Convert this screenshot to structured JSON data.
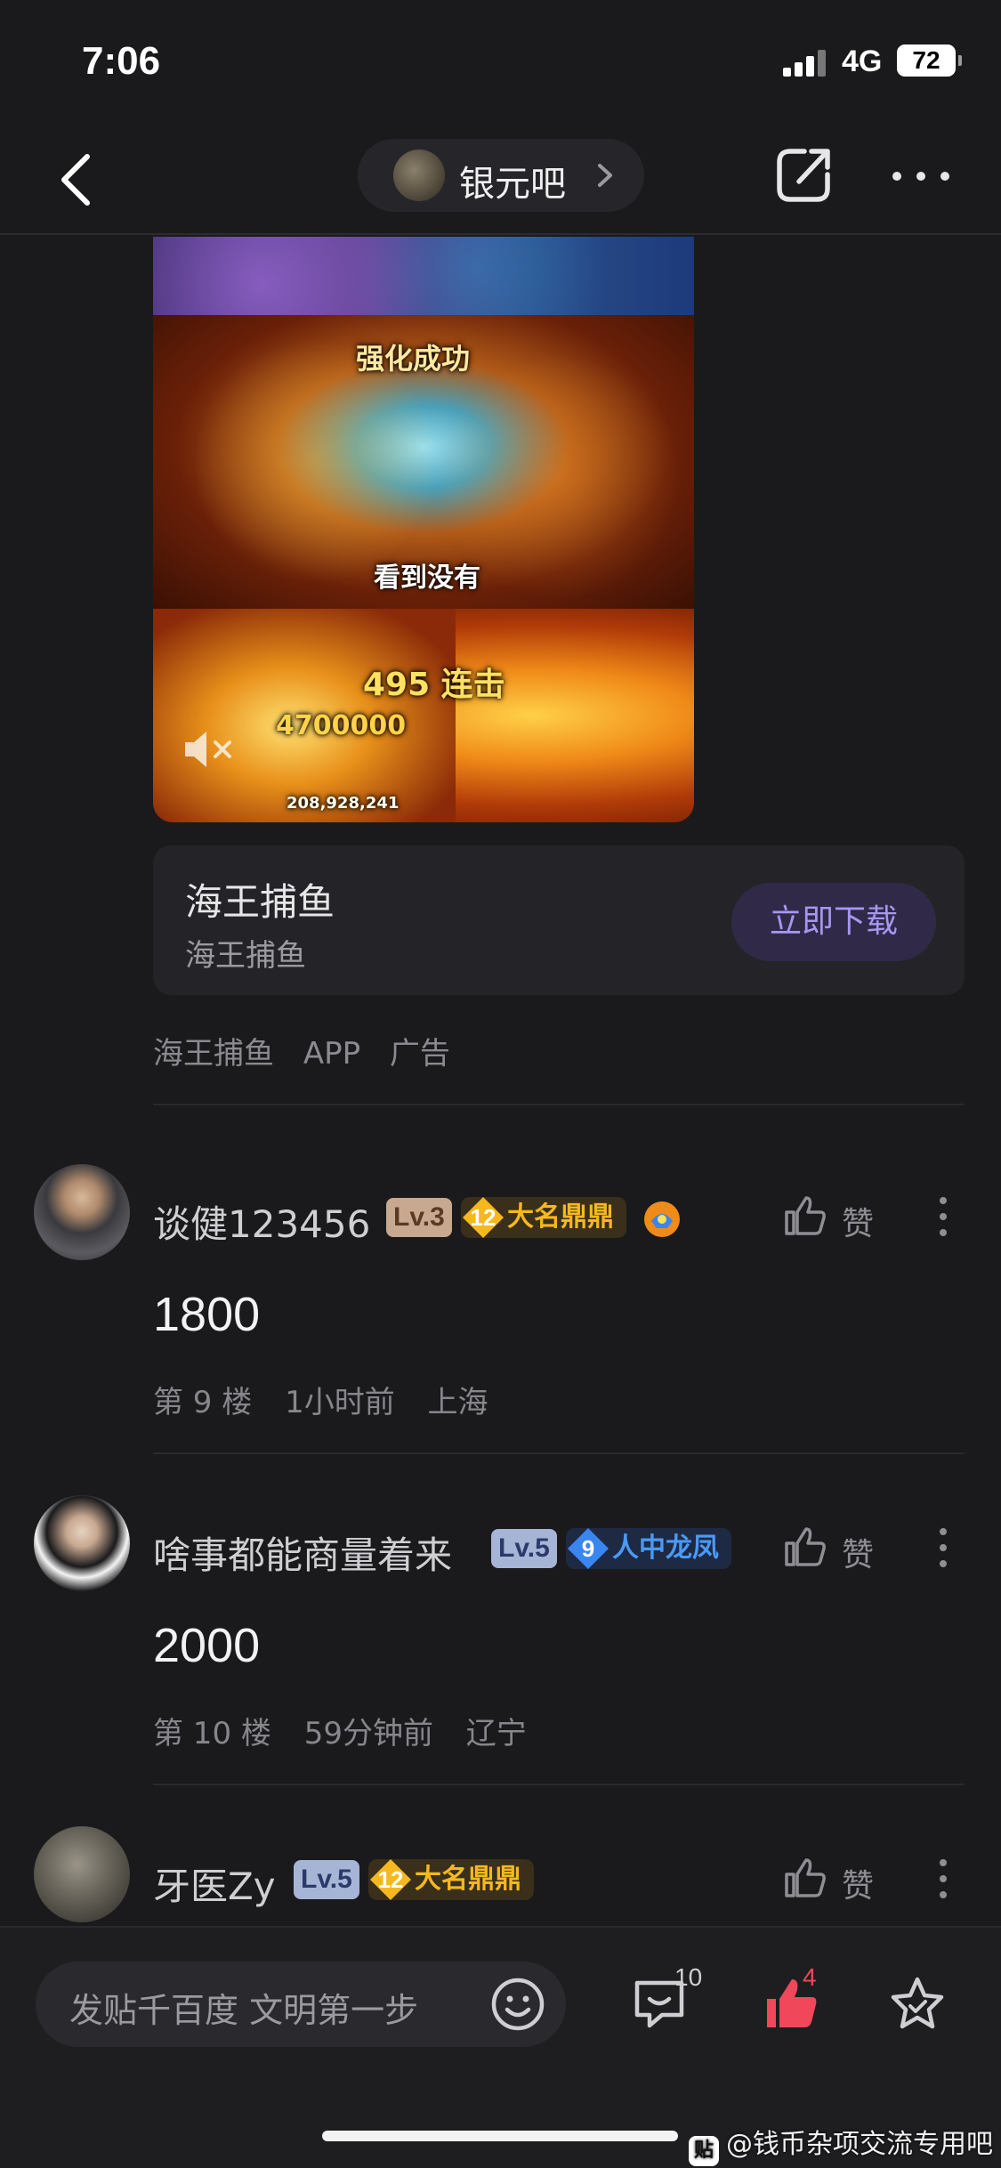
{
  "status_bar": {
    "time": "7:06",
    "network": "4G",
    "battery": "72"
  },
  "nav": {
    "forum_name": "银元吧"
  },
  "ad": {
    "image_texts": {
      "title": "强化成功",
      "caption": "看到没有",
      "combo": "495 连击",
      "score": "4700000",
      "total": "208,928,241"
    },
    "card_title": "海王捕鱼",
    "card_subtitle": "海王捕鱼",
    "download_label": "立即下载",
    "meta": [
      "海王捕鱼",
      "APP",
      "广告"
    ]
  },
  "comments": [
    {
      "username": "谈健123456",
      "level": "Lv.3",
      "title_level": "12",
      "title_name": "大名鼎鼎",
      "like_label": "赞",
      "content": "1800",
      "floor": "第 9 楼",
      "time": "1小时前",
      "location": "上海"
    },
    {
      "username": "啥事都能商量着来",
      "level": "Lv.5",
      "title_level": "9",
      "title_name": "人中龙凤",
      "like_label": "赞",
      "content": "2000",
      "floor": "第 10 楼",
      "time": "59分钟前",
      "location": "辽宁"
    },
    {
      "username": "牙医Zy",
      "level": "Lv.5",
      "title_level": "12",
      "title_name": "大名鼎鼎",
      "like_label": "赞"
    }
  ],
  "bottom_bar": {
    "reply_placeholder": "发贴千百度 文明第一步",
    "comment_count": "10",
    "like_count": "4"
  },
  "watermark": {
    "logo": "贴",
    "text": "@钱币杂项交流专用吧"
  },
  "colors": {
    "accent": "#a996f0",
    "like_red": "#f0485a",
    "gold_badge": "#f5b81e",
    "blue_badge": "#3a86f0"
  }
}
